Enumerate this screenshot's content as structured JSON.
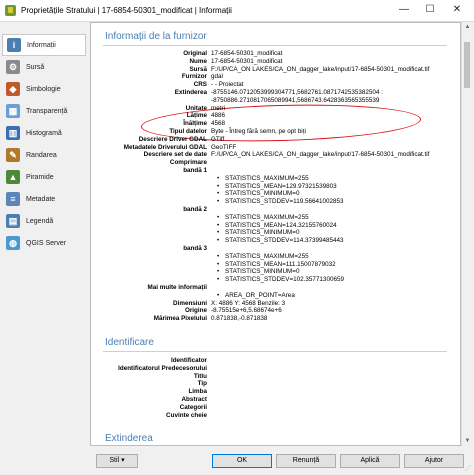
{
  "window": {
    "title": "Proprietățile Stratului | 17-6854-50301_modificat | Informații",
    "minimize": "—",
    "maximize": "☐",
    "close": "✕"
  },
  "sidebar": {
    "items": [
      {
        "label": "Informații",
        "icon": "info-icon",
        "color": "#4a7fb2",
        "glyph": "i"
      },
      {
        "label": "Sursă",
        "icon": "wrench-icon",
        "color": "#8a8a8a",
        "glyph": "⚙"
      },
      {
        "label": "Simbologie",
        "icon": "paint-icon",
        "color": "#c05a2a",
        "glyph": "◆"
      },
      {
        "label": "Transparență",
        "icon": "transparency-icon",
        "color": "#6aa0d8",
        "glyph": "▦"
      },
      {
        "label": "Histogramă",
        "icon": "histogram-icon",
        "color": "#3a6fb2",
        "glyph": "▥"
      },
      {
        "label": "Randarea",
        "icon": "brush-icon",
        "color": "#b07a2a",
        "glyph": "✎"
      },
      {
        "label": "Piramide",
        "icon": "pyramid-icon",
        "color": "#4c8a3a",
        "glyph": "▲"
      },
      {
        "label": "Metadate",
        "icon": "metadata-icon",
        "color": "#5a86b8",
        "glyph": "≡"
      },
      {
        "label": "Legendă",
        "icon": "legend-icon",
        "color": "#4a7fb2",
        "glyph": "▤"
      },
      {
        "label": "QGIS Server",
        "icon": "server-icon",
        "color": "#4a9ad2",
        "glyph": "◍"
      }
    ]
  },
  "content": {
    "section_provider": "Informații de la furnizor",
    "section_identification": "Identificare",
    "section_extent": "Extinderea",
    "rows": [
      {
        "label": "Original",
        "value": "17-6854-50301_modificat"
      },
      {
        "label": "Nume",
        "value": "17-6854-50301_modificat"
      },
      {
        "label": "Sursă",
        "value": "F:/UP/CA_ON LAKES/CA_ON_dagger_lake/input/17-6854-50301_modificat.tif"
      },
      {
        "label": "Furnizor",
        "value": "gdal"
      },
      {
        "label": "CRS",
        "value": "- - Proiectat"
      },
      {
        "label": "Extinderea",
        "value": "-8755146.0712053999304771,5682761.0871742535382504 :\n-8750886.2710817065089941,5686743.6428363565355539"
      },
      {
        "label": "Unitate",
        "value": "metri"
      },
      {
        "label": "Lățime",
        "value": "4886"
      },
      {
        "label": "Înălțime",
        "value": "4568"
      },
      {
        "label": "Tipul datelor",
        "value": "Byte - Întreg fără semn, pe opt biți"
      },
      {
        "label": "Descriere Driver GDAL",
        "value": "GTiff"
      },
      {
        "label": "Metadatele Driverului GDAL",
        "value": "GeoTIFF"
      },
      {
        "label": "Descriere set de date",
        "value": "F:/UP/CA_ON LAKES/CA_ON_dagger_lake/input/17-6854-50301_modificat.tif"
      },
      {
        "label": "Comprimare",
        "value": ""
      }
    ],
    "bands": [
      {
        "label": "bandă 1",
        "lines": [
          "",
          "STATISTICS_MAXIMUM=255",
          "STATISTICS_MEAN=129.97321539803",
          "STATISTICS_MINIMUM=0",
          "STATISTICS_STDDEV=119.56641002853"
        ]
      },
      {
        "label": "bandă 2",
        "lines": [
          "",
          "STATISTICS_MAXIMUM=255",
          "STATISTICS_MEAN=124.32155760024",
          "STATISTICS_MINIMUM=0",
          "STATISTICS_STDDEV=114.37399485443"
        ]
      },
      {
        "label": "bandă 3",
        "lines": [
          "",
          "STATISTICS_MAXIMUM=255",
          "STATISTICS_MEAN=111.15007879032",
          "STATISTICS_MINIMUM=0",
          "STATISTICS_STDDEV=102.35771300659"
        ]
      }
    ],
    "tail_rows": [
      {
        "label": "Mai multe informații",
        "value": "AREA_OR_POINT=Area"
      },
      {
        "label": "Dimensiuni",
        "value": "X: 4886 Y: 4568 Benzile: 3"
      },
      {
        "label": "Origine",
        "value": "-8.75515e+6,5.68674e+6"
      },
      {
        "label": "Mărimea Pixelului",
        "value": "0.871838,-0.871838"
      }
    ],
    "id_rows": [
      "Identificator",
      "Identificatorul Predecesorului",
      "Titlu",
      "Tip",
      "Limba",
      "Abstract",
      "Categorii",
      "Cuvinte cheie"
    ]
  },
  "footer": {
    "style": "Stil",
    "ok": "OK",
    "cancel": "Renunță",
    "apply": "Aplică",
    "help": "Ajutor"
  },
  "annotation_color": "#d6141b"
}
